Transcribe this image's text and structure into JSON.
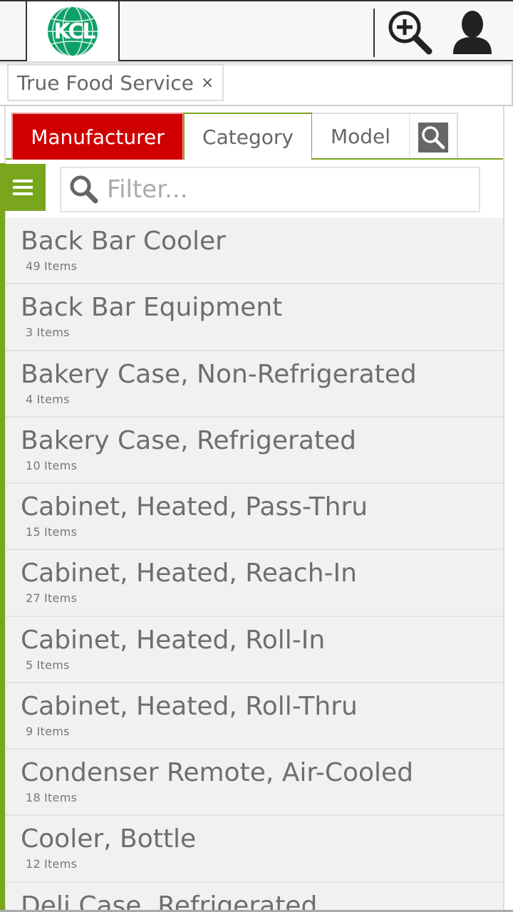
{
  "header": {
    "logo_text": "KCL",
    "colors": {
      "brand_green": "#0fa06a",
      "accent_green": "#7aa61d",
      "tab_active_red": "#d10000"
    },
    "zoom_icon": "zoom-in-icon",
    "user_icon": "user-icon"
  },
  "active_filter": {
    "label": "True Food Service",
    "remove": "×"
  },
  "tabs": {
    "manufacturer": "Manufacturer",
    "category": "Category",
    "model": "Model",
    "search_icon": "search-icon"
  },
  "filter": {
    "placeholder": "Filter..."
  },
  "list": {
    "items": [
      {
        "title": "Back Bar Cooler",
        "count": "49",
        "unit": "Items"
      },
      {
        "title": "Back Bar Equipment",
        "count": "3",
        "unit": "Items"
      },
      {
        "title": "Bakery Case, Non-Refrigerated",
        "count": "4",
        "unit": "Items"
      },
      {
        "title": "Bakery Case, Refrigerated",
        "count": "10",
        "unit": "Items"
      },
      {
        "title": "Cabinet, Heated, Pass-Thru",
        "count": "15",
        "unit": "Items"
      },
      {
        "title": "Cabinet, Heated, Reach-In",
        "count": "27",
        "unit": "Items"
      },
      {
        "title": "Cabinet, Heated, Roll-In",
        "count": "5",
        "unit": "Items"
      },
      {
        "title": "Cabinet, Heated, Roll-Thru",
        "count": "9",
        "unit": "Items"
      },
      {
        "title": "Condenser Remote, Air-Cooled",
        "count": "18",
        "unit": "Items"
      },
      {
        "title": "Cooler, Bottle",
        "count": "12",
        "unit": "Items"
      },
      {
        "title": "Deli Case, Refrigerated",
        "count": "",
        "unit": ""
      }
    ]
  }
}
